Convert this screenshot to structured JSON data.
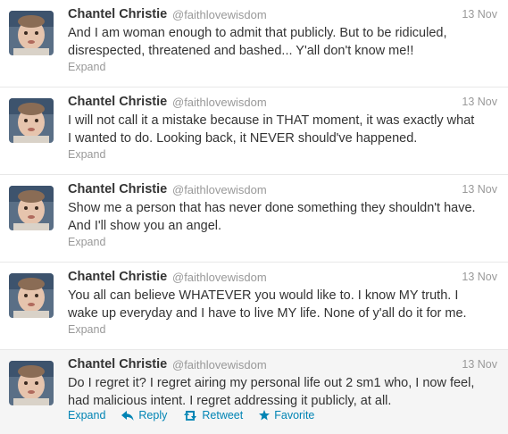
{
  "tweets": [
    {
      "name": "Chantel Christie",
      "handle": "@faithlovewisdom",
      "time": "13 Nov",
      "lines": [
        "And I am woman enough to admit that publicly. But to be ridiculed,",
        "disrespected, threatened and bashed... Y'all don't know me!!"
      ],
      "expand": "Expand"
    },
    {
      "name": "Chantel Christie",
      "handle": "@faithlovewisdom",
      "time": "13 Nov",
      "lines": [
        "I will not call it a mistake because in THAT moment, it was exactly what",
        "I wanted to do. Looking back, it NEVER should've happened."
      ],
      "expand": "Expand"
    },
    {
      "name": "Chantel Christie",
      "handle": "@faithlovewisdom",
      "time": "13 Nov",
      "lines": [
        "Show me a person that has never done something they shouldn't have.",
        "And I'll show you an angel."
      ],
      "expand": "Expand"
    },
    {
      "name": "Chantel Christie",
      "handle": "@faithlovewisdom",
      "time": "13 Nov",
      "lines": [
        "You all can believe WHATEVER you would like to. I know MY truth. I",
        "wake up everyday and I have to live MY life. None of y'all do it for me."
      ],
      "expand": "Expand"
    },
    {
      "name": "Chantel Christie",
      "handle": "@faithlovewisdom",
      "time": "13 Nov",
      "lines": [
        "Do I regret it? I regret airing my personal life out 2 sm1 who, I now feel,",
        "had malicious intent. I regret addressing it publicly, at all."
      ],
      "expand": "Expand",
      "reply": "Reply",
      "retweet": "Retweet",
      "favorite": "Favorite"
    }
  ],
  "icons": [
    "reply-icon",
    "retweet-icon",
    "favorite-icon"
  ],
  "colors": {
    "link": "#0084b4",
    "muted": "#999999",
    "text": "#333333",
    "hover_bg": "#f5f5f5"
  }
}
